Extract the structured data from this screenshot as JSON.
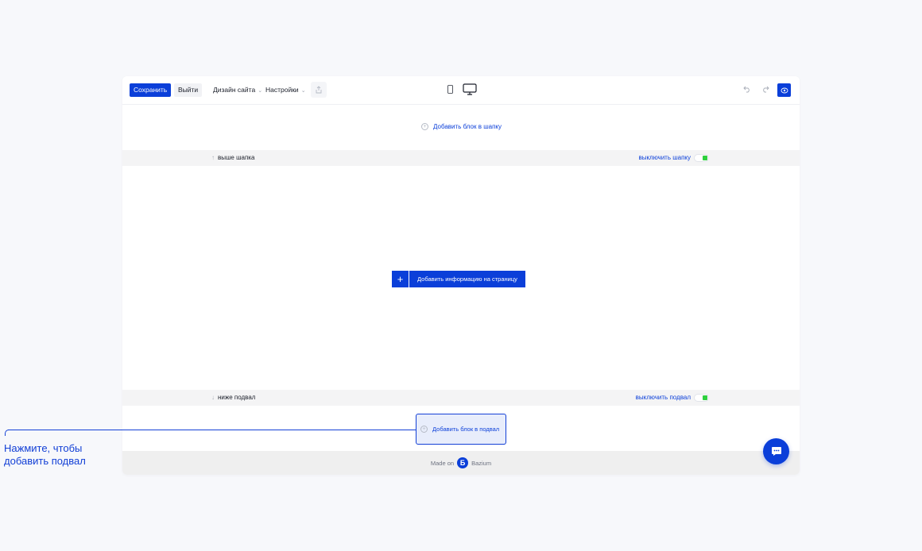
{
  "toolbar": {
    "save_label": "Сохранить",
    "exit_label": "Выйти",
    "design_label": "Дизайн сайта",
    "settings_label": "Настройки"
  },
  "header_section": {
    "add_block_label": "Добавить блок в шапку",
    "strip_label": "выше шапка",
    "toggle_label": "выключить шапку",
    "toggle_on": true
  },
  "main": {
    "add_info_label": "Добавить информацию на страницу"
  },
  "footer_section": {
    "strip_label": "ниже подвал",
    "toggle_label": "выключить подвал",
    "toggle_on": true,
    "add_block_label": "Добавить блок в подвал"
  },
  "made_on": {
    "prefix": "Made on",
    "brand": "Bazium",
    "logo_letter": "Б"
  },
  "callout": {
    "text": "Нажмите, чтобы добавить подвал"
  },
  "colors": {
    "accent": "#0b3fd9",
    "toggle_green": "#2fd03f",
    "page_bg": "#f7f8fb"
  },
  "icons": [
    "mobile-icon",
    "desktop-icon",
    "share-icon",
    "undo-icon",
    "redo-icon",
    "eye-icon",
    "chat-icon"
  ]
}
